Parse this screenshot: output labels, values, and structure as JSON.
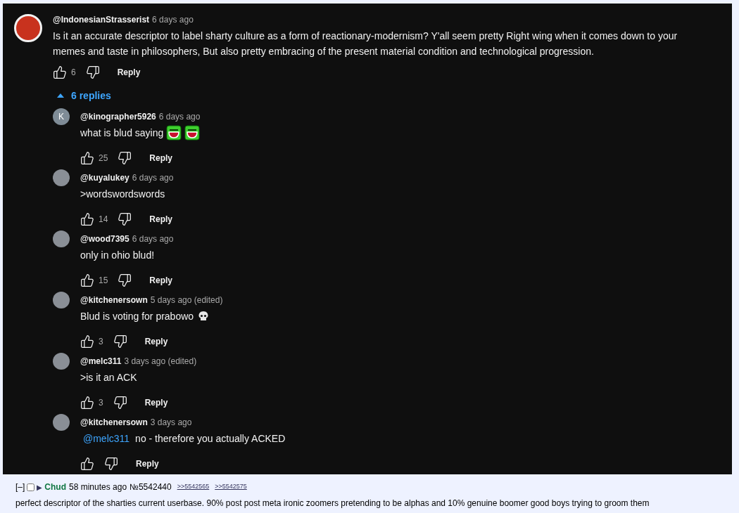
{
  "comment": {
    "author": "@IndonesianStrasserist",
    "time": "6 days ago",
    "body": "Is it an accurate descriptor to label sharty culture as a form of reactionary-modernism? Y'all seem pretty Right wing when it comes down to your memes and taste in philosophers, But also pretty embracing of the present material condition and technological progression.",
    "likes": "6",
    "reply_label": "Reply",
    "replies_toggle": {
      "label": "6 replies",
      "expanded": true
    }
  },
  "replies": [
    {
      "author": "@kinographer5926",
      "time": "6 days ago",
      "avatar_letter": "K",
      "body": "what is blud saying",
      "emojis": [
        {
          "kind": "laughing-face"
        },
        {
          "kind": "laughing-face"
        }
      ],
      "likes": "25",
      "reply_label": "Reply"
    },
    {
      "author": "@kuyalukey",
      "time": "6 days ago",
      "body": ">wordswordswords",
      "likes": "14",
      "reply_label": "Reply"
    },
    {
      "author": "@wood7395",
      "time": "6 days ago",
      "body": "only in ohio blud!",
      "likes": "15",
      "reply_label": "Reply"
    },
    {
      "author": "@kitchenersown",
      "time": "5 days ago (edited)",
      "body": "Blud is voting for prabowo",
      "emojis": [
        {
          "kind": "skull"
        }
      ],
      "likes": "3",
      "reply_label": "Reply"
    },
    {
      "author": "@melc311",
      "time": "3 days ago (edited)",
      "body": ">is it an ACK",
      "likes": "3",
      "reply_label": "Reply"
    },
    {
      "author": "@kitchenersown",
      "time": "3 days ago",
      "mention": "@melc311",
      "body": "no - therefore you actually ACKED",
      "reply_label": "Reply"
    }
  ],
  "post": {
    "collapse": "[–]",
    "checked": false,
    "arrow": "▶",
    "name": "Chud",
    "time": "58 minutes ago",
    "number": "№5542440",
    "backlinks": [
      ">>5542565",
      ">>5542575"
    ],
    "body": "perfect descriptor of the sharties current userbase. 90% post post meta ironic zoomers pretending to be alphas and 10% genuine boomer good boys trying to groom them"
  }
}
